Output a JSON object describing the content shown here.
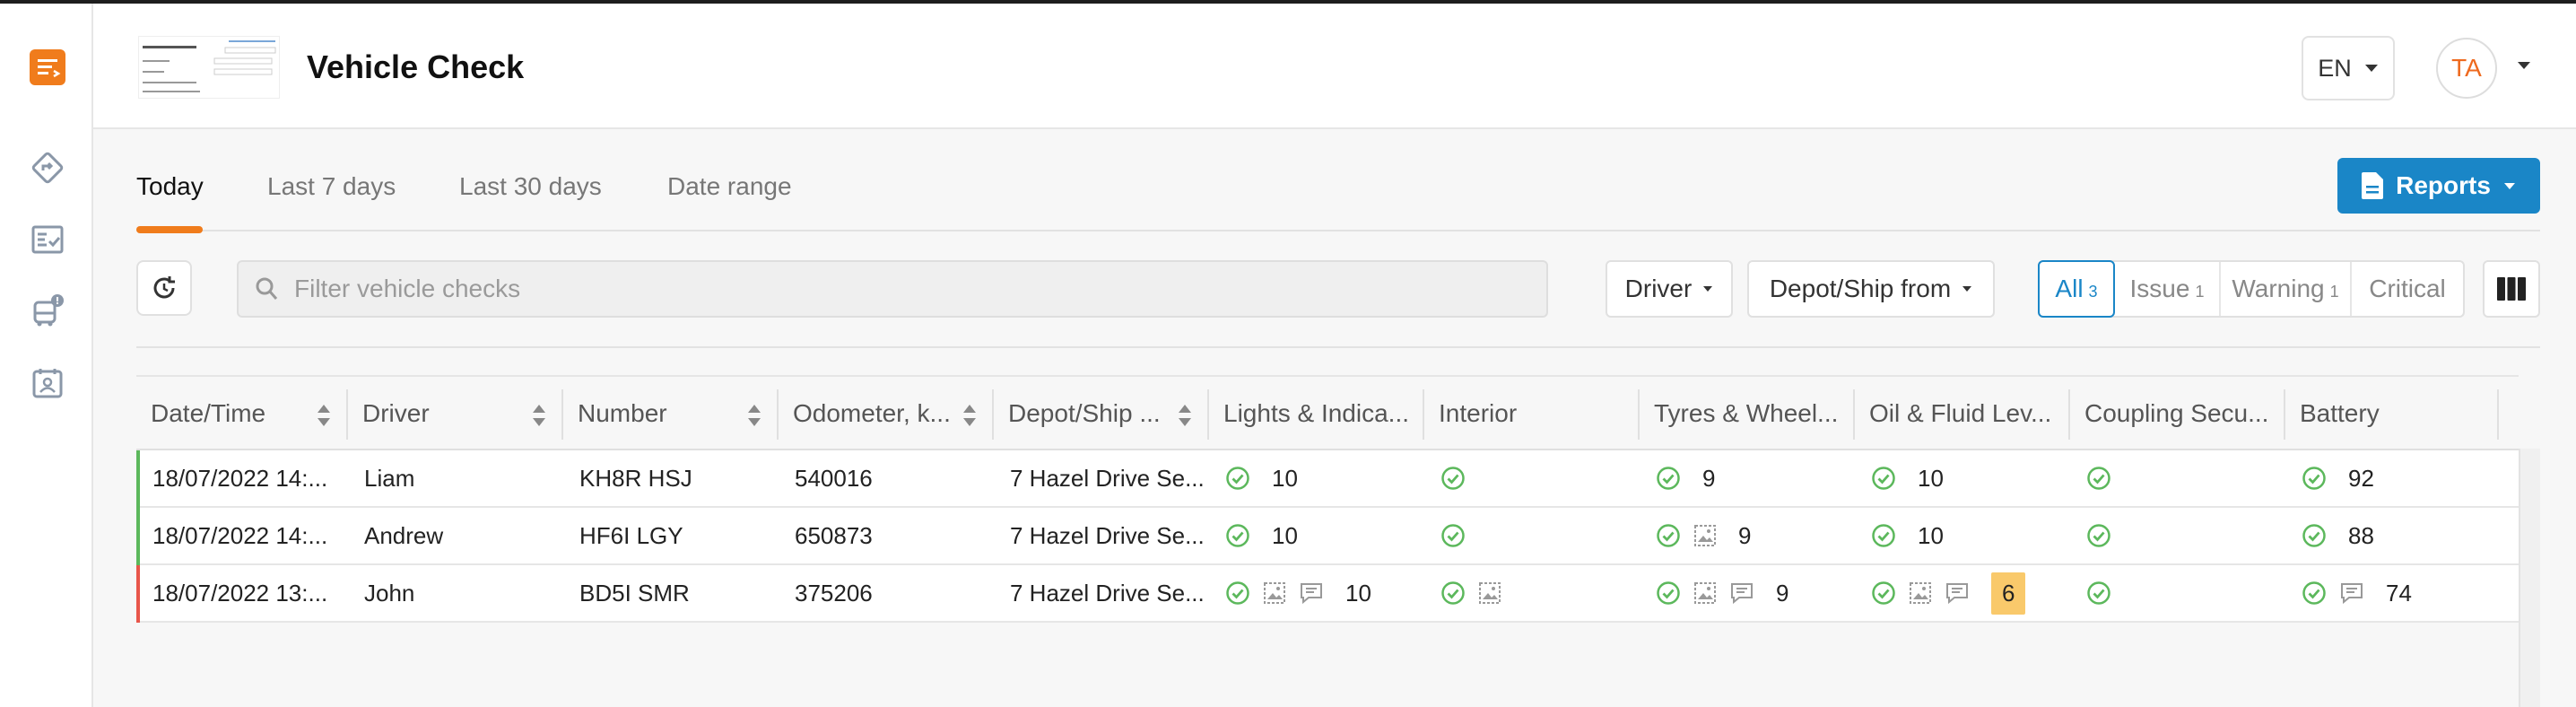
{
  "header": {
    "title": "Vehicle Check",
    "language": "EN",
    "user_initials": "TA"
  },
  "tabs": [
    {
      "label": "Today",
      "active": true
    },
    {
      "label": "Last 7 days",
      "active": false
    },
    {
      "label": "Last 30 days",
      "active": false
    },
    {
      "label": "Date range",
      "active": false
    }
  ],
  "reports_label": "Reports",
  "search": {
    "placeholder": "Filter vehicle checks",
    "value": ""
  },
  "filters": {
    "driver": "Driver",
    "depot": "Depot/Ship from"
  },
  "status_filters": [
    {
      "label": "All",
      "count": "3",
      "active": true
    },
    {
      "label": "Issue",
      "count": "1",
      "active": false
    },
    {
      "label": "Warning",
      "count": "1",
      "active": false
    },
    {
      "label": "Critical",
      "count": "",
      "active": false
    }
  ],
  "table": {
    "columns": [
      "Date/Time",
      "Driver",
      "Number",
      "Odometer, k...",
      "Depot/Ship ...",
      "Lights & Indica...",
      "Interior",
      "Tyres & Wheel...",
      "Oil & Fluid Lev...",
      "Coupling Secu...",
      "Battery"
    ],
    "rows": [
      {
        "status": "ok",
        "datetime": "18/07/2022 14:...",
        "driver": "Liam",
        "number": "KH8R HSJ",
        "odometer": "540016",
        "depot": "7 Hazel Drive Se...",
        "lights": {
          "icons": [
            "check"
          ],
          "value": "10"
        },
        "interior": {
          "icons": [
            "check"
          ],
          "value": ""
        },
        "tyres": {
          "icons": [
            "check"
          ],
          "value": "9"
        },
        "oil": {
          "icons": [
            "check"
          ],
          "value": "10",
          "warn": false
        },
        "coupling": {
          "icons": [
            "check"
          ],
          "value": ""
        },
        "battery": {
          "icons": [
            "check"
          ],
          "value": "92"
        }
      },
      {
        "status": "ok",
        "datetime": "18/07/2022 14:...",
        "driver": "Andrew",
        "number": "HF6I LGY",
        "odometer": "650873",
        "depot": "7 Hazel Drive Se...",
        "lights": {
          "icons": [
            "check"
          ],
          "value": "10"
        },
        "interior": {
          "icons": [
            "check"
          ],
          "value": ""
        },
        "tyres": {
          "icons": [
            "check",
            "image"
          ],
          "value": "9"
        },
        "oil": {
          "icons": [
            "check"
          ],
          "value": "10",
          "warn": false
        },
        "coupling": {
          "icons": [
            "check"
          ],
          "value": ""
        },
        "battery": {
          "icons": [
            "check"
          ],
          "value": "88"
        }
      },
      {
        "status": "issue",
        "datetime": "18/07/2022 13:...",
        "driver": "John",
        "number": "BD5I SMR",
        "odometer": "375206",
        "depot": "7 Hazel Drive Se...",
        "lights": {
          "icons": [
            "check",
            "image",
            "comment"
          ],
          "value": "10"
        },
        "interior": {
          "icons": [
            "check",
            "image"
          ],
          "value": ""
        },
        "tyres": {
          "icons": [
            "check",
            "image",
            "comment"
          ],
          "value": "9"
        },
        "oil": {
          "icons": [
            "check",
            "image",
            "comment"
          ],
          "value": "6",
          "warn": true
        },
        "coupling": {
          "icons": [
            "check"
          ],
          "value": ""
        },
        "battery": {
          "icons": [
            "check",
            "comment"
          ],
          "value": "74"
        }
      }
    ]
  },
  "colors": {
    "accent": "#1a86c7",
    "brand": "#f07c1c",
    "ok": "#5cb85c",
    "issue": "#e8564a",
    "warn": "#f9c96b"
  }
}
